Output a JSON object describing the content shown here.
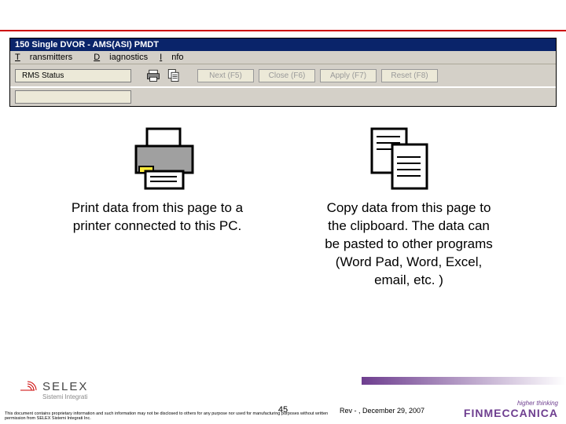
{
  "window": {
    "title": "150 Single DVOR - AMS(ASI) PMDT",
    "menu": {
      "m1": "Transmitters",
      "m2": "Diagnostics",
      "m3": "Info"
    },
    "tab": "RMS Status",
    "buttons": {
      "next": "Next (F5)",
      "close": "Close (F6)",
      "apply": "Apply (F7)",
      "reset": "Reset (F8)"
    }
  },
  "captions": {
    "print": "Print data from this page to a printer connected to this PC.",
    "copy": "Copy data from this page to the clipboard. The data can be pasted to other programs (Word Pad, Word, Excel, email, etc. )"
  },
  "footer": {
    "selex": "SELEX",
    "selex_sub": "Sistemi Integrati",
    "page": "45",
    "rev": "Rev - , December 29, 2007",
    "finm_tag": "higher thinking",
    "finm": "FINMECCANICA",
    "disclaimer": "This document contains proprietary information and such information may not be disclosed to others for any purpose nor used for manufacturing purposes without written permission from SELEX Sistemi Integrati Inc."
  }
}
